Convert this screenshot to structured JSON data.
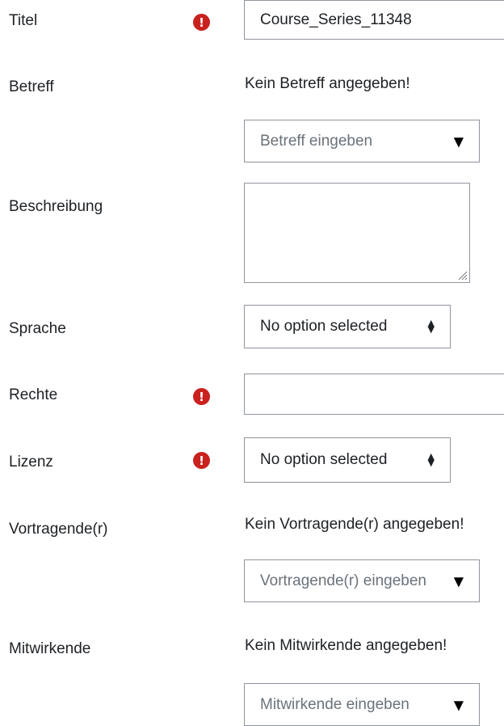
{
  "fields": {
    "titel": {
      "label": "Titel",
      "value": "Course_Series_11348"
    },
    "betreff": {
      "label": "Betreff",
      "status": "Kein Betreff angegeben!",
      "placeholder": "Betreff eingeben"
    },
    "beschreibung": {
      "label": "Beschreibung",
      "value": ""
    },
    "sprache": {
      "label": "Sprache",
      "selected": "No option selected"
    },
    "rechte": {
      "label": "Rechte",
      "value": ""
    },
    "lizenz": {
      "label": "Lizenz",
      "selected": "No option selected"
    },
    "vortragende": {
      "label": "Vortragende(r)",
      "status": "Kein Vortragende(r) angegeben!",
      "placeholder": "Vortragende(r) eingeben"
    },
    "mitwirkende": {
      "label": "Mitwirkende",
      "status": "Kein Mitwirkende angegeben!",
      "placeholder": "Mitwirkende eingeben"
    }
  },
  "icons": {
    "required": "exclamation-circle-icon",
    "dropdown": "triangle-down-icon",
    "select": "up-down-caret-icon",
    "resize": "resize-grip-icon"
  },
  "colors": {
    "required_icon": "#c9211e",
    "border": "#8f959e",
    "text": "#1d2125",
    "placeholder": "#6a737b"
  }
}
